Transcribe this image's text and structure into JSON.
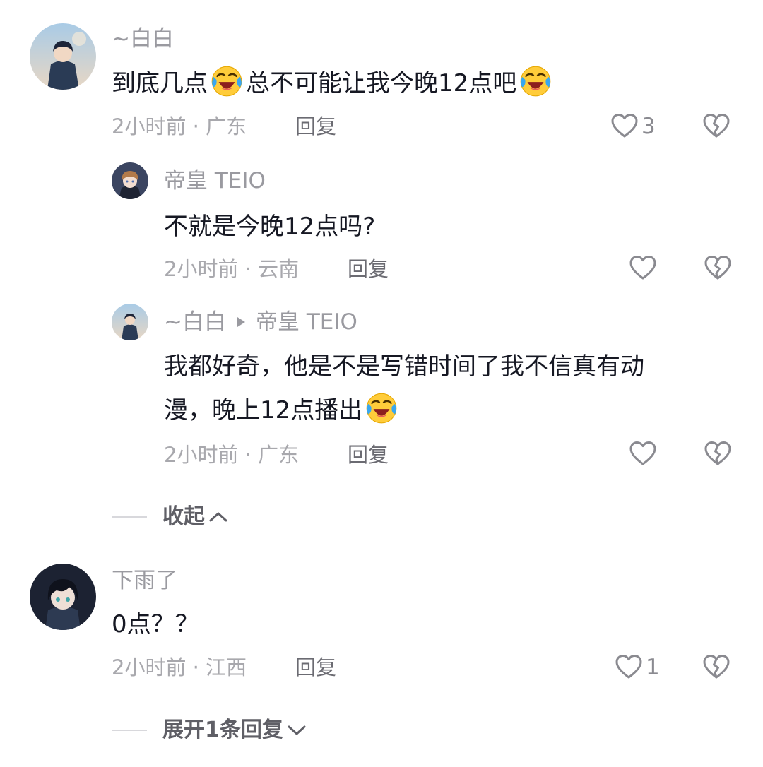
{
  "comments": [
    {
      "username": "~白白",
      "content_parts": [
        "到底几点",
        "总不可能让我今晚12点吧"
      ],
      "meta": "2小时前 · 广东",
      "reply_label": "回复",
      "like_count": "3",
      "replies": [
        {
          "username": "帝皇 TEIO",
          "content": "不就是今晚12点吗?",
          "meta": "2小时前 · 云南",
          "reply_label": "回复",
          "like_count": ""
        },
        {
          "username": "~白白",
          "reply_to": "帝皇 TEIO",
          "content_line1": "我都好奇，他是不是写错时间了我不信真有动",
          "content_line2": "漫，晚上12点播出",
          "meta": "2小时前 · 广东",
          "reply_label": "回复",
          "like_count": ""
        }
      ],
      "collapse_label": "收起"
    },
    {
      "username": "下雨了",
      "content": "0点？？",
      "meta": "2小时前 · 江西",
      "reply_label": "回复",
      "like_count": "1",
      "expand_label": "展开1条回复"
    }
  ],
  "icons": {
    "like": "heart-outline-icon",
    "dislike": "broken-heart-icon",
    "emoji": "laughing-crying-emoji",
    "collapse": "chevron-up-icon",
    "expand": "chevron-down-icon",
    "reply_arrow": "triangle-right-icon"
  },
  "colors": {
    "text_primary": "#161823",
    "text_secondary": "#9a9aa0",
    "icon": "#8a8a90"
  }
}
